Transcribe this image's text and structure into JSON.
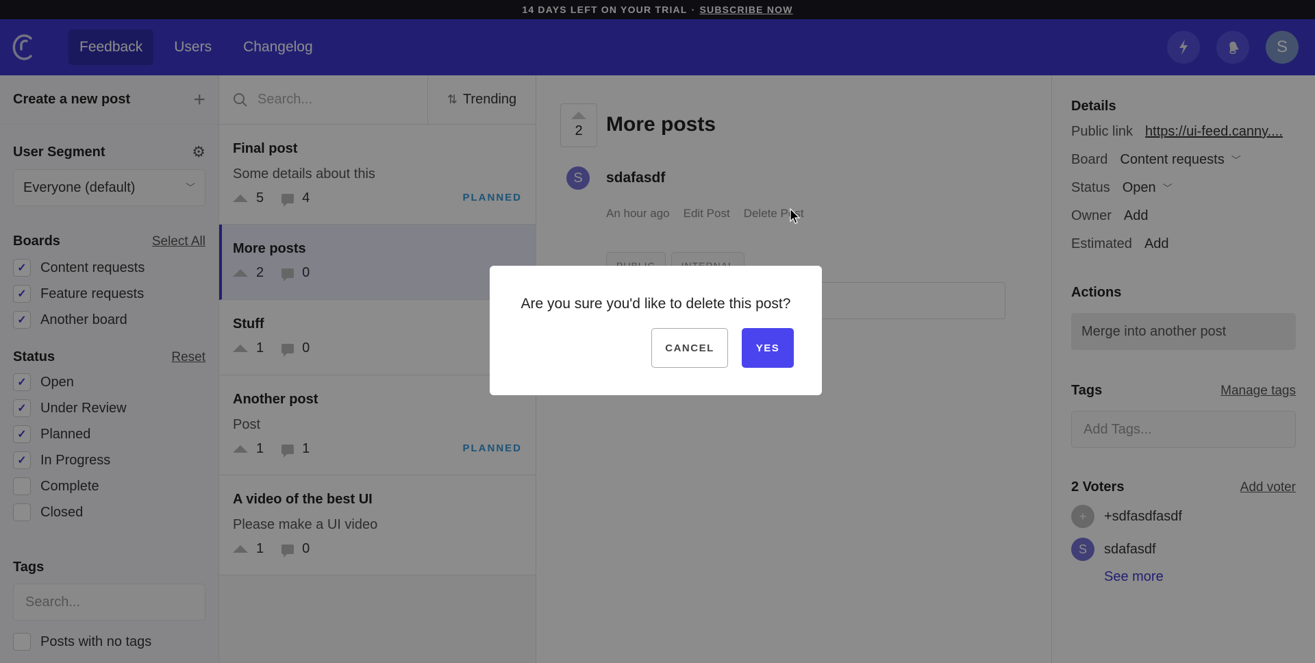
{
  "trial_bar": {
    "text": "14 DAYS LEFT ON YOUR TRIAL",
    "separator": "·",
    "link": "SUBSCRIBE NOW"
  },
  "topnav": {
    "items": [
      {
        "label": "Feedback",
        "active": true
      },
      {
        "label": "Users",
        "active": false
      },
      {
        "label": "Changelog",
        "active": false
      }
    ],
    "icons": [
      "lightning-icon",
      "bell-icon"
    ],
    "avatar_initial": "S"
  },
  "sidebar": {
    "create_label": "Create a new post",
    "segment": {
      "heading": "User Segment",
      "selected": "Everyone (default)"
    },
    "boards": {
      "heading": "Boards",
      "action": "Select All",
      "items": [
        {
          "label": "Content requests",
          "checked": true
        },
        {
          "label": "Feature requests",
          "checked": true
        },
        {
          "label": "Another board",
          "checked": true
        }
      ]
    },
    "status": {
      "heading": "Status",
      "action": "Reset",
      "items": [
        {
          "label": "Open",
          "checked": true
        },
        {
          "label": "Under Review",
          "checked": true
        },
        {
          "label": "Planned",
          "checked": true
        },
        {
          "label": "In Progress",
          "checked": true
        },
        {
          "label": "Complete",
          "checked": false
        },
        {
          "label": "Closed",
          "checked": false
        }
      ]
    },
    "tags": {
      "heading": "Tags",
      "search_placeholder": "Search...",
      "no_tags_label": "Posts with no tags",
      "no_tags_checked": false
    }
  },
  "postlist": {
    "search_placeholder": "Search...",
    "sort_label": "Trending",
    "posts": [
      {
        "title": "Final post",
        "details": "Some details about this",
        "votes": "5",
        "comments": "4",
        "status": "PLANNED",
        "selected": false
      },
      {
        "title": "More posts",
        "details": "",
        "votes": "2",
        "comments": "0",
        "status": "",
        "selected": true
      },
      {
        "title": "Stuff",
        "details": "",
        "votes": "1",
        "comments": "0",
        "status": "",
        "selected": false
      },
      {
        "title": "Another post",
        "details": "Post",
        "votes": "1",
        "comments": "1",
        "status": "PLANNED",
        "selected": false
      },
      {
        "title": "A video of the best UI",
        "details": "Please make a UI video",
        "votes": "1",
        "comments": "0",
        "status": "",
        "selected": false
      }
    ]
  },
  "detail": {
    "votes": "2",
    "title": "More posts",
    "author_initial": "S",
    "author": "sdafasdf",
    "time": "An hour ago",
    "edit_label": "Edit Post",
    "delete_label": "Delete Post",
    "tabs": [
      "PUBLIC",
      "INTERNAL"
    ]
  },
  "right": {
    "details_heading": "Details",
    "public_link_label": "Public link",
    "public_link": "https://ui-feed.canny....",
    "board_label": "Board",
    "board_value": "Content requests",
    "status_label": "Status",
    "status_value": "Open",
    "owner_label": "Owner",
    "owner_value": "Add",
    "estimated_label": "Estimated",
    "estimated_value": "Add",
    "actions_heading": "Actions",
    "merge_label": "Merge into another post",
    "tags_heading": "Tags",
    "manage_tags": "Manage tags",
    "tags_placeholder": "Add Tags...",
    "voters_heading": "2 Voters",
    "add_voter": "Add voter",
    "voters": [
      {
        "initial": "+",
        "name": "+sdfasdfasdf",
        "color": "#bdbdbd"
      },
      {
        "initial": "S",
        "name": "sdafasdf",
        "color": "#7773d8"
      }
    ],
    "see_more": "See more"
  },
  "modal": {
    "question": "Are you sure you'd like to delete this post?",
    "cancel": "CANCEL",
    "yes": "YES"
  },
  "colors": {
    "brand": "#3f3acf",
    "primary_button": "#4a44ee",
    "planned": "#3598db"
  }
}
